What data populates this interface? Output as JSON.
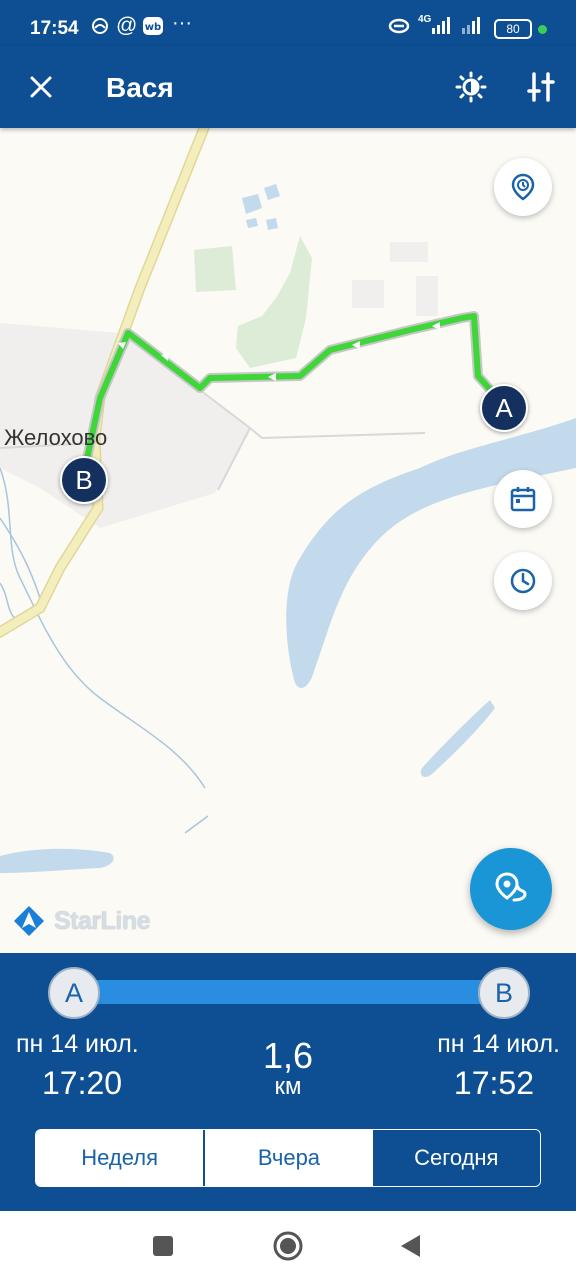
{
  "status_bar": {
    "time": "17:54",
    "left_icons": [
      "weather-icon",
      "at-icon",
      "wb-app-icon",
      "more-dots-icon"
    ],
    "network_label": "4G",
    "battery": "80",
    "accent_dot_color": "#3ccc5a"
  },
  "header": {
    "title": "Вася",
    "close_icon": "close-icon",
    "theme_icon": "brightness-icon",
    "settings_icon": "sliders-icon",
    "background_color": "#0d4f92"
  },
  "map": {
    "town_label": "Желохово",
    "marker_a": "A",
    "marker_b": "B",
    "brand": "StarLine",
    "route_color": "#3fd63a",
    "water_color": "#c3d9ec",
    "road_color": "#f2ebb1",
    "buttons": [
      "history-pin-icon",
      "calendar-icon",
      "clock-icon"
    ],
    "fab_icon": "route-pin-icon",
    "fab_color": "#1a95d6"
  },
  "trip": {
    "start_label": "A",
    "end_label": "B",
    "start_date": "пн 14 июл.",
    "start_time": "17:20",
    "end_date": "пн 14 июл.",
    "end_time": "17:52",
    "distance_value": "1,6",
    "distance_unit": "км",
    "slider_color": "#2a8ee0"
  },
  "period_tabs": {
    "items": [
      "Неделя",
      "Вчера",
      "Сегодня"
    ],
    "selected": "Сегодня"
  },
  "nav_bar": {
    "buttons": [
      "recents-square-icon",
      "home-circle-icon",
      "back-triangle-icon"
    ]
  }
}
